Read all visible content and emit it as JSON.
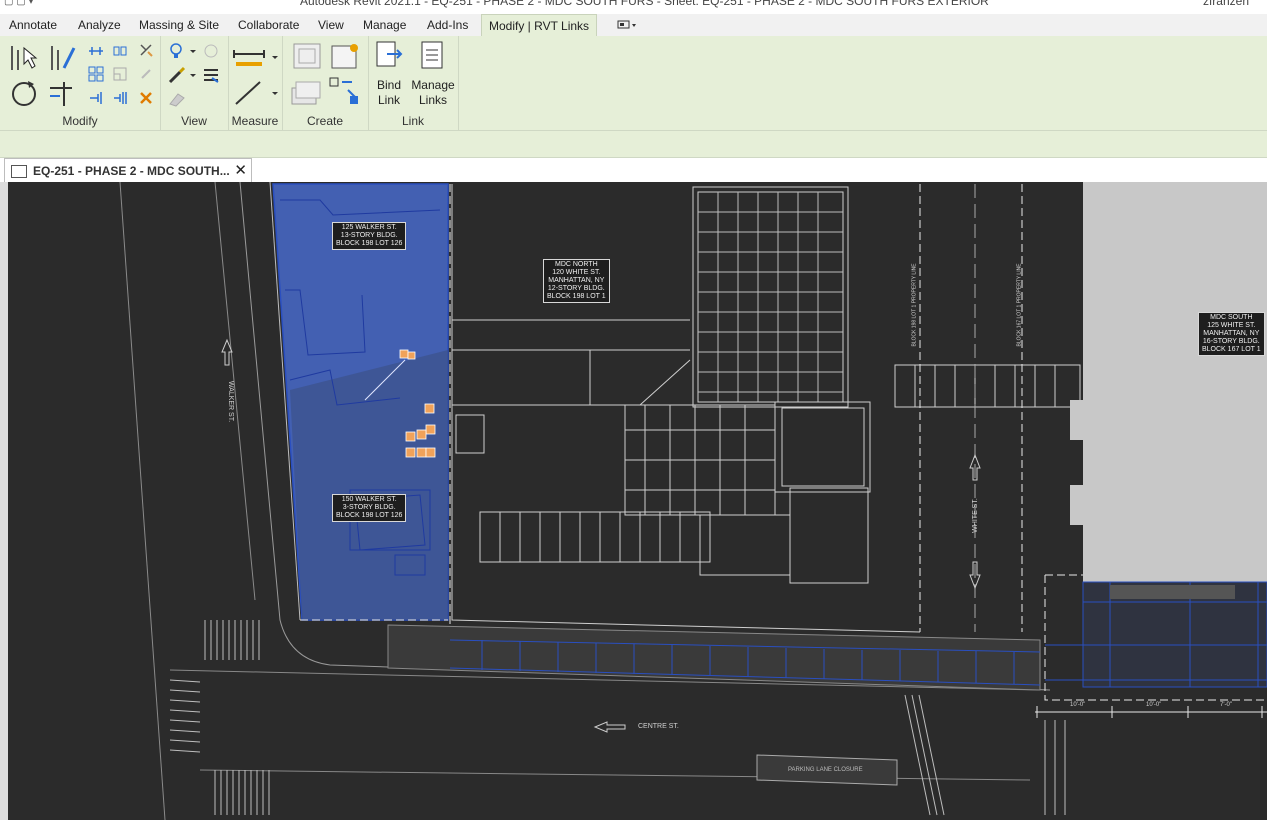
{
  "window": {
    "title": "Autodesk Revit 2021.1 - EQ-251 - PHASE 2 - MDC SOUTH FURS - Sheet: EQ-251 - PHASE 2 - MDC SOUTH FURS EXTERIOR",
    "user": "zfranzen"
  },
  "ribbon_tabs": [
    {
      "label": "Annotate"
    },
    {
      "label": "Analyze"
    },
    {
      "label": "Massing & Site"
    },
    {
      "label": "Collaborate"
    },
    {
      "label": "View"
    },
    {
      "label": "Manage"
    },
    {
      "label": "Add-Ins"
    },
    {
      "label": "Modify | RVT Links",
      "active": true
    }
  ],
  "ribbon": {
    "panels": {
      "modify": "Modify",
      "view": "View",
      "measure": "Measure",
      "create": "Create",
      "link": "Link"
    },
    "buttons": {
      "bind_link": "Bind\nLink",
      "manage_links": "Manage\nLinks"
    }
  },
  "document_tab": {
    "title": "EQ-251 - PHASE 2 - MDC SOUTH..."
  },
  "drawing": {
    "labels": {
      "walker125": "125 WALKER ST.\n13-STORY BLDG.\nBLOCK 198 LOT 126",
      "walker150": "150 WALKER ST.\n3-STORY BLDG.\nBLOCK 198 LOT 126",
      "mdc_north": "MDC NORTH\n120 WHITE ST.\nMANHATTAN, NY\n12-STORY BLDG.\nBLOCK 198 LOT 1",
      "mdc_south": "MDC SOUTH\n125 WHITE ST.\nMANHATTAN, NY\n16-STORY BLDG.\nBLOCK 167 LOT 1"
    },
    "streets": {
      "walker": "WALKER ST.",
      "white": "WHITE ST.",
      "centre": "CENTRE ST.",
      "parking": "PARKING LANE CLOSURE",
      "lot_line_198": "BLOCK 198 LOT 1 PROPERTY LINE",
      "lot_line_167": "BLOCK 167 LOT 1 PROPERTY LINE"
    },
    "dimensions": [
      "10'-0\"",
      "10'-0\"",
      "7'-0\""
    ],
    "colors": {
      "selection": "#4a6fd8",
      "background": "#2b2b2b",
      "lines": "#cfcfcf",
      "gray_block": "#c8c8c8"
    }
  }
}
